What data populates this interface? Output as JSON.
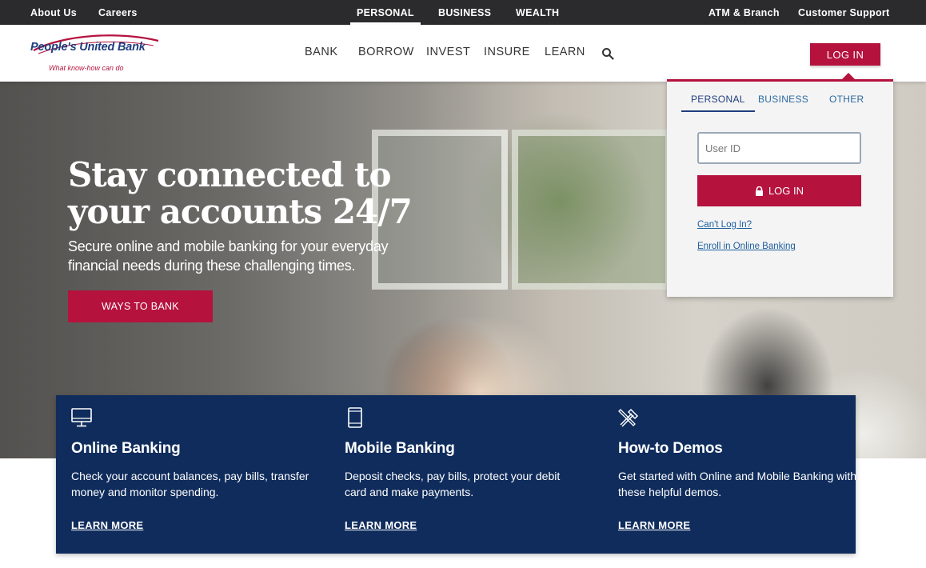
{
  "topbar": {
    "left": [
      "About Us",
      "Careers"
    ],
    "segments": [
      "PERSONAL",
      "BUSINESS",
      "WEALTH"
    ],
    "active_segment": "PERSONAL",
    "right": [
      "ATM & Branch",
      "Customer Support"
    ]
  },
  "header": {
    "logo_text": "People's United Bank",
    "logo_tagline": "What know-how can do",
    "nav": [
      "BANK",
      "BORROW",
      "INVEST",
      "INSURE",
      "LEARN"
    ],
    "login_label": "LOG IN"
  },
  "hero": {
    "title": "Stay connected to your accounts 24/7",
    "subtitle": "Secure online and mobile banking for your everyday financial needs during these challenging times.",
    "cta_label": "WAYS TO BANK"
  },
  "login_panel": {
    "tabs": [
      "PERSONAL",
      "BUSINESS",
      "OTHER"
    ],
    "active_tab": "PERSONAL",
    "userid_placeholder": "User ID",
    "submit_label": "LOG IN",
    "links": [
      "Can't Log In?",
      "Enroll in Online Banking"
    ]
  },
  "features": [
    {
      "icon": "desktop-icon",
      "title": "Online Banking",
      "desc": "Check your account balances, pay bills, transfer money and monitor spending.",
      "link": "LEARN MORE"
    },
    {
      "icon": "mobile-phone-icon",
      "title": "Mobile Banking",
      "desc": "Deposit checks, pay bills, protect your debit card and make payments.",
      "link": "LEARN MORE"
    },
    {
      "icon": "tools-icon",
      "title": "How-to Demos",
      "desc": "Get started with Online and Mobile Banking with these helpful demos.",
      "link": "LEARN MORE"
    }
  ],
  "colors": {
    "brand_red": "#b5123e",
    "navy": "#0f2c5c",
    "topbar": "#2b2b2d",
    "logo_blue": "#1f3e7e"
  }
}
